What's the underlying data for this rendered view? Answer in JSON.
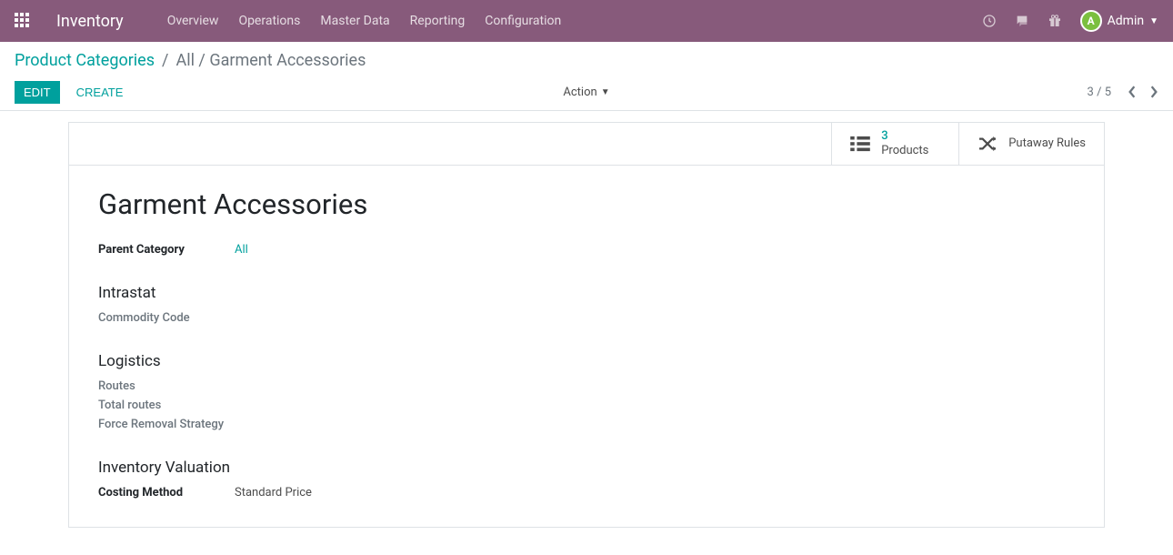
{
  "topbar": {
    "brand": "Inventory",
    "menu": [
      "Overview",
      "Operations",
      "Master Data",
      "Reporting",
      "Configuration"
    ],
    "user": "Admin"
  },
  "breadcrumb": {
    "root": "Product Categories",
    "current": "All / Garment Accessories"
  },
  "buttons": {
    "edit": "Edit",
    "create": "Create",
    "action": "Action"
  },
  "pager": {
    "current": "3",
    "total": "5"
  },
  "stat": {
    "products_count": "3",
    "products_label": "Products",
    "putaway_label": "Putaway Rules"
  },
  "record": {
    "title": "Garment Accessories",
    "parent_category_label": "Parent Category",
    "parent_category_value": "All",
    "intrastat_title": "Intrastat",
    "commodity_code_label": "Commodity Code",
    "logistics_title": "Logistics",
    "routes_label": "Routes",
    "total_routes_label": "Total routes",
    "force_removal_label": "Force Removal Strategy",
    "valuation_title": "Inventory Valuation",
    "costing_method_label": "Costing Method",
    "costing_method_value": "Standard Price"
  }
}
